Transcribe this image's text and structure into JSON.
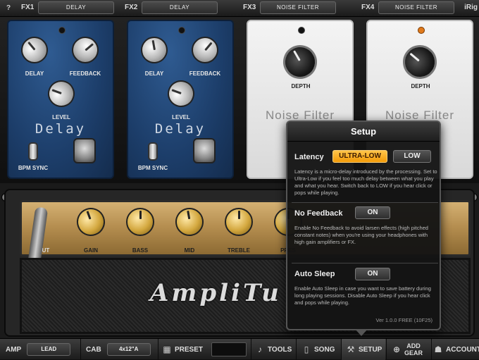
{
  "fx_bar": {
    "help": "?",
    "slots": [
      {
        "label": "FX1",
        "effect": "DELAY"
      },
      {
        "label": "FX2",
        "effect": "DELAY"
      },
      {
        "label": "FX3",
        "effect": "NOISE FILTER"
      },
      {
        "label": "FX4",
        "effect": "NOISE FILTER"
      }
    ],
    "irig": "iRig"
  },
  "pedals": [
    {
      "name": "Delay",
      "knobs": [
        "DELAY",
        "FEEDBACK",
        "LEVEL"
      ],
      "switch_label": "BPM SYNC",
      "led_on": false
    },
    {
      "name": "Delay",
      "knobs": [
        "DELAY",
        "FEEDBACK",
        "LEVEL"
      ],
      "switch_label": "BPM SYNC",
      "led_on": false
    },
    {
      "name": "Noise Filter",
      "knobs": [
        "DEPTH"
      ],
      "led_on": false
    },
    {
      "name": "Noise Filter",
      "knobs": [
        "DEPTH"
      ],
      "led_on": true
    }
  ],
  "amp": {
    "input_label": "UT",
    "knobs": [
      "GAIN",
      "BASS",
      "MID",
      "TREBLE",
      "PRES"
    ],
    "scale_max": "10",
    "logo": "AmpliTu"
  },
  "setup": {
    "title": "Setup",
    "latency": {
      "heading": "Latency",
      "options": [
        "ULTRA-LOW",
        "LOW"
      ],
      "selected": "ULTRA-LOW",
      "description": "Latency is a micro-delay introduced by the processing. Set to Ultra-Low if you feel too much delay between what you play and what you hear. Switch back to LOW if you hear click or pops while playing."
    },
    "no_feedback": {
      "heading": "No Feedback",
      "value": "ON",
      "description": "Enable No Feedback to avoid larsen effects (high pitched constant notes) when you're using your headphones with high gain amplifiers or FX."
    },
    "auto_sleep": {
      "heading": "Auto Sleep",
      "value": "ON",
      "description": "Enable Auto Sleep in case you want to save battery during long playing sessions. Disable Auto Sleep if you hear click and pops while playing."
    },
    "version": "Ver 1.0.0 FREE (10F25)"
  },
  "bottom_bar": {
    "amp_label": "AMP",
    "amp_value": "LEAD",
    "cab_label": "CAB",
    "cab_value": "4x12\"A",
    "preset": "PRESET",
    "tools": "TOOLS",
    "song": "SONG",
    "setup": "SETUP",
    "add_gear_1": "ADD",
    "add_gear_2": "GEAR",
    "account": "ACCOUNT"
  },
  "colors": {
    "accent_orange": "#f29a08",
    "pedal_blue": "#1c3d69",
    "amp_gold": "#b38c4e"
  }
}
